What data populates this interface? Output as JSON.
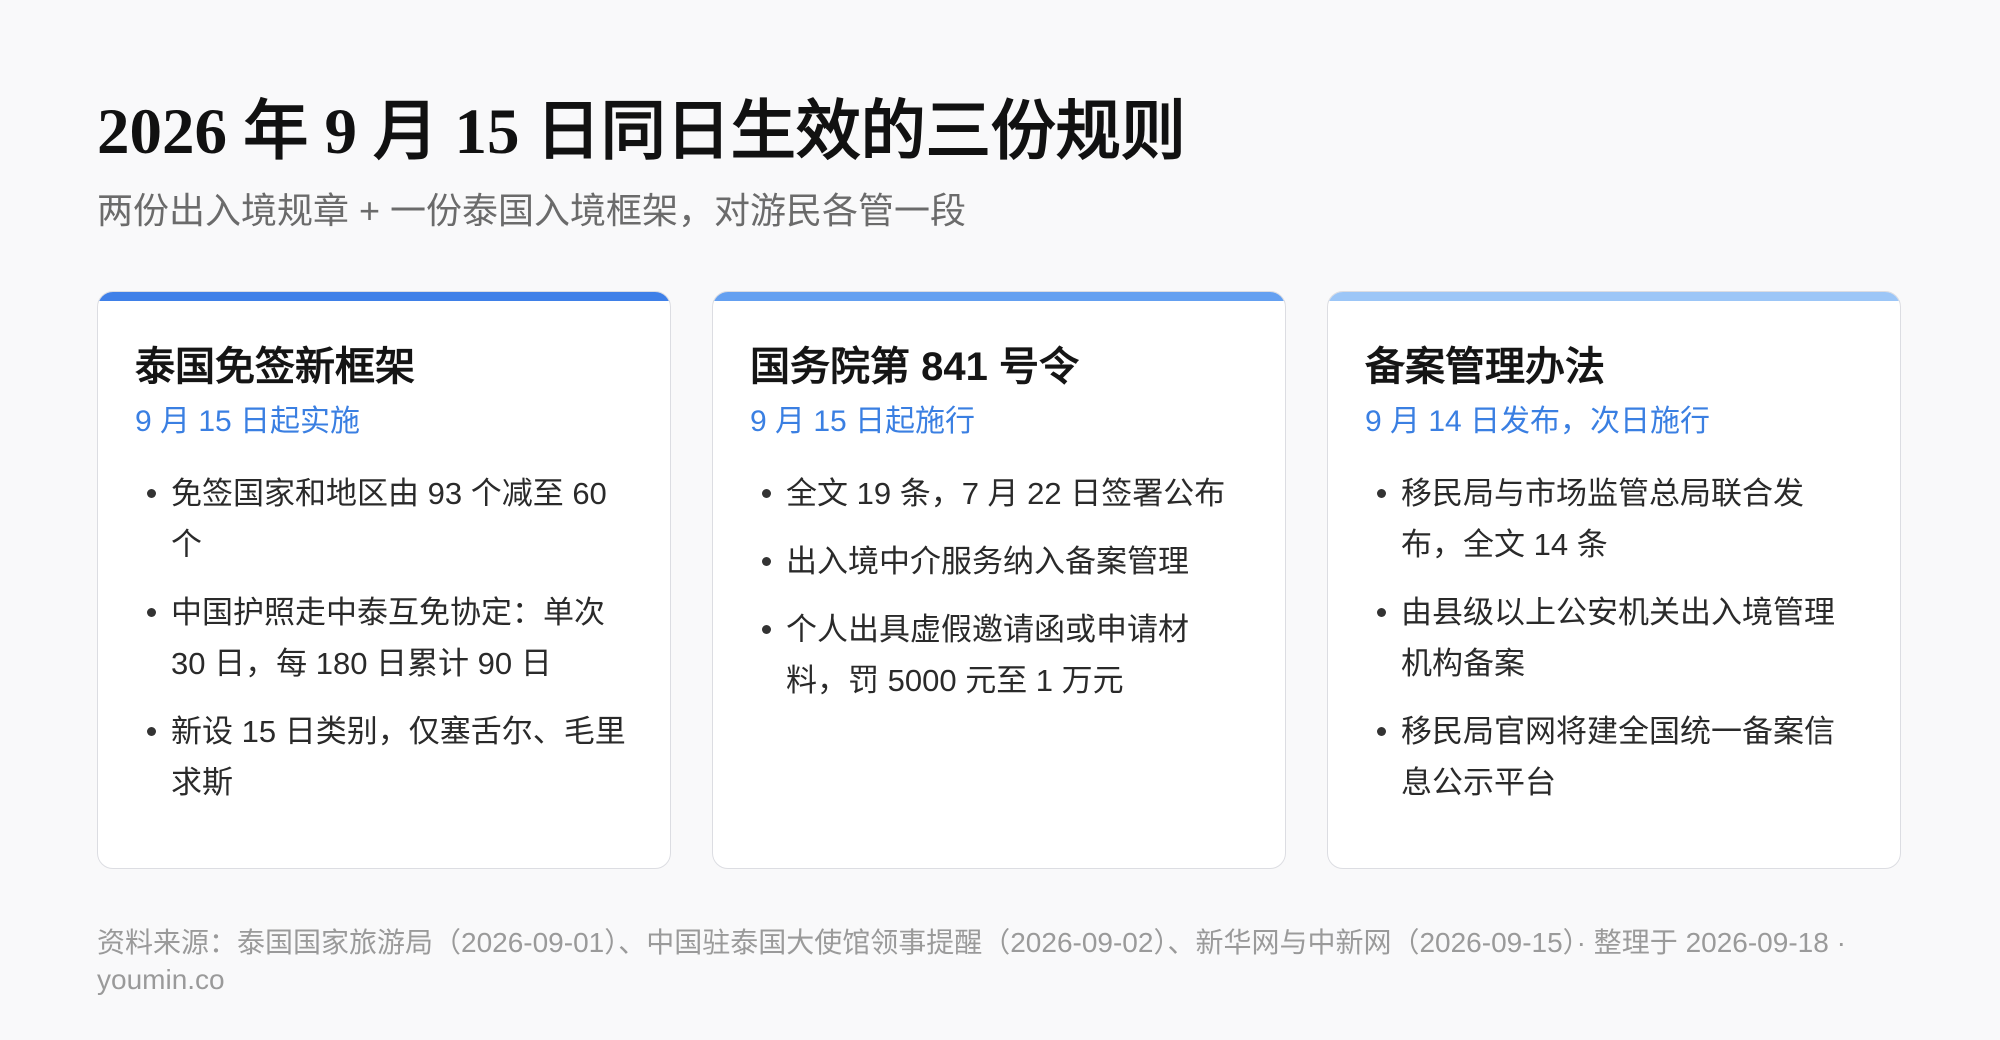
{
  "header": {
    "title": "2026 年 9 月 15 日同日生效的三份规则",
    "subtitle": "两份出入境规章 + 一份泰国入境框架，对游民各管一段"
  },
  "cards": [
    {
      "title": "泰国免签新框架",
      "date": "9 月 15 日起实施",
      "accent_color": "#3f80e8",
      "items": [
        "免签国家和地区由 93 个减至 60 个",
        "中国护照走中泰互免协定：单次 30 日，每 180 日累计 90 日",
        "新设 15 日类别，仅塞舌尔、毛里求斯"
      ]
    },
    {
      "title": "国务院第 841 号令",
      "date": "9 月 15 日起施行",
      "accent_color": "#64a0f1",
      "items": [
        "全文 19 条，7 月 22 日签署公布",
        "出入境中介服务纳入备案管理",
        "个人出具虚假邀请函或申请材料，罚 5000 元至 1 万元"
      ]
    },
    {
      "title": "备案管理办法",
      "date": "9 月 14 日发布，次日施行",
      "accent_color": "#9cc6f7",
      "items": [
        "移民局与市场监管总局联合发布，全文 14 条",
        "由县级以上公安机关出入境管理机构备案",
        "移民局官网将建全国统一备案信息公示平台"
      ]
    }
  ],
  "footer": {
    "source": "资料来源：泰国国家旅游局（2026-09-01）、中国驻泰国大使馆领事提醒（2026-09-02）、新华网与中新网（2026-09-15）· 整理于 2026-09-18 · youmin.co"
  },
  "colors": {
    "date_text": "#3a7fe2",
    "page_background": "#f9f9fa"
  }
}
